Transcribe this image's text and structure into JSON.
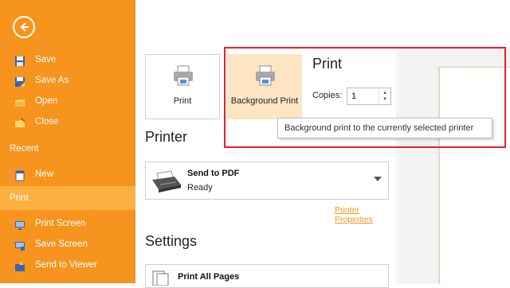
{
  "sidebar": {
    "items": [
      {
        "label": "Save",
        "icon": "save-icon"
      },
      {
        "label": "Save As",
        "icon": "save-as-icon"
      },
      {
        "label": "Open",
        "icon": "open-folder-icon"
      },
      {
        "label": "Close",
        "icon": "close-folder-icon"
      }
    ],
    "section_recent": "Recent",
    "new_label": "New",
    "print_label": "Print",
    "bottom_items": [
      {
        "label": "Print Screen",
        "icon": "print-screen-icon"
      },
      {
        "label": "Save Screen",
        "icon": "save-screen-icon"
      },
      {
        "label": "Send to Viewer",
        "icon": "send-to-viewer-icon"
      }
    ]
  },
  "print_panel": {
    "print_button": "Print",
    "background_print_button": "Background Print",
    "title": "Print",
    "copies_label": "Copies:",
    "copies_value": "1",
    "tooltip": "Background print to the currently selected printer"
  },
  "printer": {
    "section_title": "Printer",
    "name": "Send to PDF",
    "status": "Ready",
    "properties_link": "Printer Properties"
  },
  "settings": {
    "section_title": "Settings",
    "pages_option": "Print All Pages"
  },
  "colors": {
    "sidebar_bg": "#f7941e",
    "sidebar_selected": "#fbb040",
    "highlight_border": "#e8202a",
    "link": "#f7941e"
  }
}
